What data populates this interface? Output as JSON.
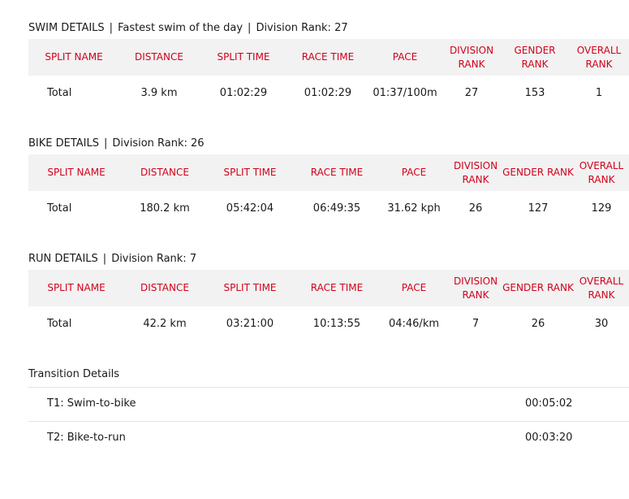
{
  "swim": {
    "label": "SWIM DETAILS",
    "note": "Fastest swim of the day",
    "division_rank": "Division Rank: 27",
    "headers": [
      "SPLIT NAME",
      "DISTANCE",
      "SPLIT TIME",
      "RACE TIME",
      "PACE",
      "DIVISION RANK",
      "GENDER RANK",
      "OVERALL RANK"
    ],
    "row": [
      "Total",
      "3.9 km",
      "01:02:29",
      "01:02:29",
      "01:37/100m",
      "27",
      "153",
      "1"
    ]
  },
  "bike": {
    "label": "BIKE DETAILS",
    "division_rank": "Division Rank: 26",
    "headers": [
      "SPLIT NAME",
      "DISTANCE",
      "SPLIT TIME",
      "RACE TIME",
      "PACE",
      "DIVISION RANK",
      "GENDER RANK",
      "OVERALL RANK"
    ],
    "row": [
      "Total",
      "180.2 km",
      "05:42:04",
      "06:49:35",
      "31.62 kph",
      "26",
      "127",
      "129"
    ]
  },
  "run": {
    "label": "RUN DETAILS",
    "division_rank": "Division Rank: 7",
    "headers": [
      "SPLIT NAME",
      "DISTANCE",
      "SPLIT TIME",
      "RACE TIME",
      "PACE",
      "DIVISION RANK",
      "GENDER RANK",
      "OVERALL RANK"
    ],
    "row": [
      "Total",
      "42.2 km",
      "03:21:00",
      "10:13:55",
      "04:46/km",
      "7",
      "26",
      "30"
    ]
  },
  "transitions": {
    "title": "Transition Details",
    "t1": {
      "label": "T1: Swim-to-bike",
      "time": "00:05:02"
    },
    "t2": {
      "label": "T2: Bike-to-run",
      "time": "00:03:20"
    }
  },
  "colors": {
    "header_text": "#d0021b",
    "header_bg": "#f2f2f2"
  }
}
